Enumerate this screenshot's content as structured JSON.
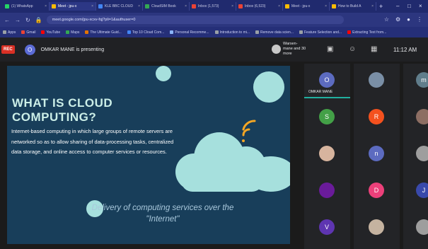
{
  "browser": {
    "tabs": [
      {
        "label": "(1) WhatsApp",
        "color": "#25d366"
      },
      {
        "label": "Meet - jpu-x",
        "color": "#fbbc04"
      },
      {
        "label": "KLE BBC CLOUD",
        "color": "#4285f4"
      },
      {
        "label": "CloudSIM Book",
        "color": "#34a853"
      },
      {
        "label": "Inbox (1,573)",
        "color": "#ea4335"
      },
      {
        "label": "Inbox (6,523)",
        "color": "#ea4335"
      },
      {
        "label": "Meet - jpu-x",
        "color": "#fbbc04"
      },
      {
        "label": "How to Build A",
        "color": "#fbbc04"
      }
    ],
    "url": "meet.google.com/jpu-xcxv-fqj?pli=1&authuser=0",
    "bookmarks": [
      {
        "label": "Apps",
        "color": "#9aa0a6"
      },
      {
        "label": "Gmail",
        "color": "#ea4335"
      },
      {
        "label": "YouTube",
        "color": "#ff0000"
      },
      {
        "label": "Maps",
        "color": "#34a853"
      },
      {
        "label": "The Ultimate Guid...",
        "color": "#e37400"
      },
      {
        "label": "Top 10 Cloud Com...",
        "color": "#4285f4"
      },
      {
        "label": "Personal Recomme...",
        "color": "#8ab4f8"
      },
      {
        "label": "Introduction to mi...",
        "color": "#9aa0a6"
      },
      {
        "label": "Remove data scien...",
        "color": "#9aa0a6"
      },
      {
        "label": "Feature Selection and...",
        "color": "#9aa0a6"
      },
      {
        "label": "Extracting Text from...",
        "color": "#ff0000"
      }
    ]
  },
  "meet": {
    "rec_label": "REC",
    "presenter_initial": "O",
    "presenting_text": "OMKAR MANE is presenting",
    "others_text": "Warsen-mane and 30 more",
    "time": "11:12 AM"
  },
  "slide": {
    "title": "WHAT IS CLOUD COMPUTING?",
    "body": "Internet-based computing in which large groups of remote servers are networked so as to allow sharing of data-processing tasks, centralized data storage, and online access to computer services or resources.",
    "caption": "Delivery of computing services over the \"Internet\""
  },
  "participants": [
    {
      "initial": "O",
      "name": "OMKAR MANE",
      "color": "#5c6bc0",
      "photo": false
    },
    {
      "initial": "",
      "name": "",
      "color": "#7a8fa6",
      "photo": true
    },
    {
      "initial": "m",
      "name": "",
      "color": "#607d8b",
      "photo": false
    },
    {
      "initial": "S",
      "name": "",
      "color": "#43a047",
      "photo": false
    },
    {
      "initial": "R",
      "name": "",
      "color": "#f4511e",
      "photo": false
    },
    {
      "initial": "",
      "name": "",
      "color": "#8d6e63",
      "photo": true
    },
    {
      "initial": "",
      "name": "",
      "color": "#d7b49e",
      "photo": true
    },
    {
      "initial": "n",
      "name": "",
      "color": "#5c6bc0",
      "photo": false
    },
    {
      "initial": "",
      "name": "",
      "color": "#9e9e9e",
      "photo": true
    },
    {
      "initial": "",
      "name": "",
      "color": "#6a1b9a",
      "photo": true
    },
    {
      "initial": "D",
      "name": "",
      "color": "#ec407a",
      "photo": false
    },
    {
      "initial": "J",
      "name": "",
      "color": "#3949ab",
      "photo": false
    },
    {
      "initial": "V",
      "name": "",
      "color": "#5e35b1",
      "photo": false
    },
    {
      "initial": "",
      "name": "",
      "color": "#c5b3a0",
      "photo": true
    },
    {
      "initial": "",
      "name": "",
      "color": "#9e9e9e",
      "photo": true
    }
  ]
}
